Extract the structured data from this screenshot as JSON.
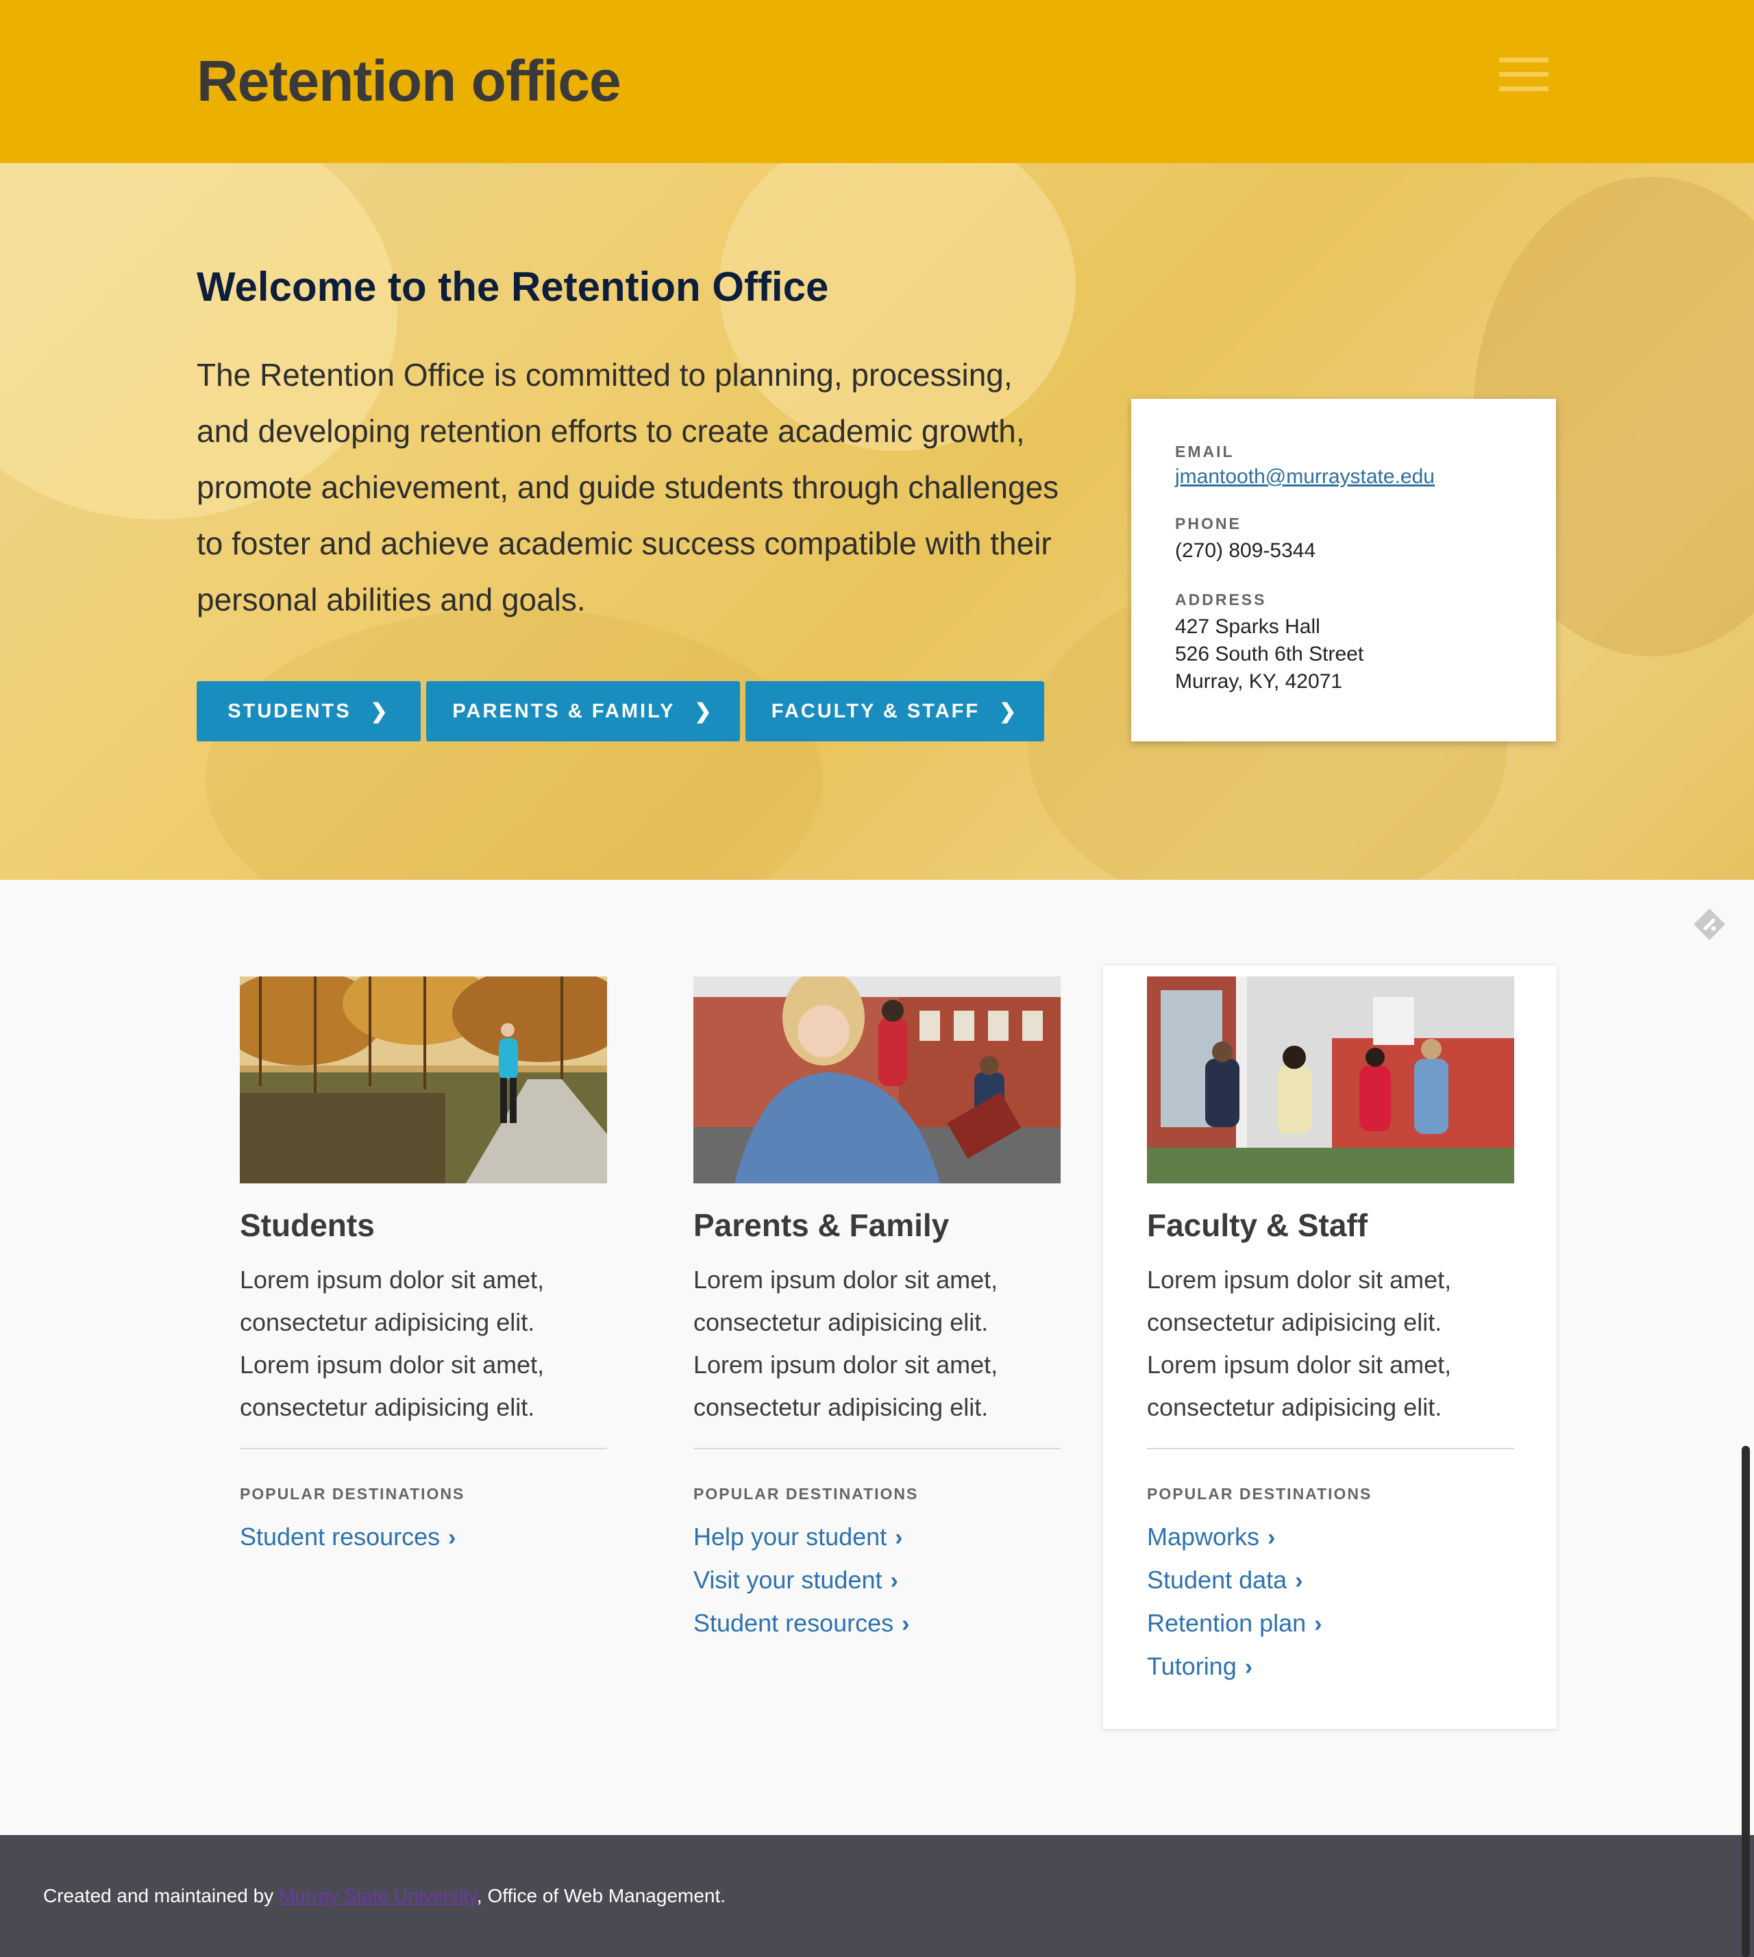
{
  "header": {
    "site_title": "Retention office",
    "menu_icon": "hamburger-menu-icon"
  },
  "hero": {
    "title": "Welcome to the Retention Office",
    "text": "The Retention Office is committed to planning, processing, and developing retention efforts to create academic growth, promote achievement, and guide students through challenges to foster and achieve academic success compatible with their personal abilities and goals.",
    "buttons": [
      {
        "label": "STUDENTS",
        "icon": "chevron-right-icon"
      },
      {
        "label": "PARENTS & FAMILY",
        "icon": "chevron-right-icon"
      },
      {
        "label": "FACULTY & STAFF",
        "icon": "chevron-right-icon"
      }
    ]
  },
  "contact": {
    "email_label": "EMAIL",
    "email": "jmantooth@murraystate.edu",
    "phone_label": "PHONE",
    "phone": "(270) 809-5344",
    "address_label": "ADDRESS",
    "address_lines": [
      "427 Sparks Hall",
      "526 South 6th Street",
      "Murray, KY, 42071"
    ]
  },
  "cards": [
    {
      "title": "Students",
      "text": "Lorem ipsum dolor sit amet, consectetur adipisicing elit. Lorem ipsum dolor sit amet, consectetur adipisicing elit.",
      "popular_label": "POPULAR DESTINATIONS",
      "links": [
        "Student resources"
      ]
    },
    {
      "title": "Parents & Family",
      "text": "Lorem ipsum dolor sit amet, consectetur adipisicing elit. Lorem ipsum dolor sit amet, consectetur adipisicing elit.",
      "popular_label": "POPULAR DESTINATIONS",
      "links": [
        "Help your student",
        "Visit your student",
        "Student resources"
      ]
    },
    {
      "title": "Faculty & Staff",
      "text": "Lorem ipsum dolor sit amet, consectetur adipisicing elit. Lorem ipsum dolor sit amet, consectetur adipisicing elit.",
      "popular_label": "POPULAR DESTINATIONS",
      "links": [
        "Mapworks",
        "Student data",
        "Retention plan",
        "Tutoring"
      ]
    }
  ],
  "footer": {
    "prefix": "Created and maintained by ",
    "link_text": "Murray State University",
    "suffix": ", Office of Web Management."
  },
  "colors": {
    "header_bg": "#ecb000",
    "cta_bg": "#1a8dbf",
    "link": "#2d72b0",
    "footer_bg": "#4a4a52"
  }
}
